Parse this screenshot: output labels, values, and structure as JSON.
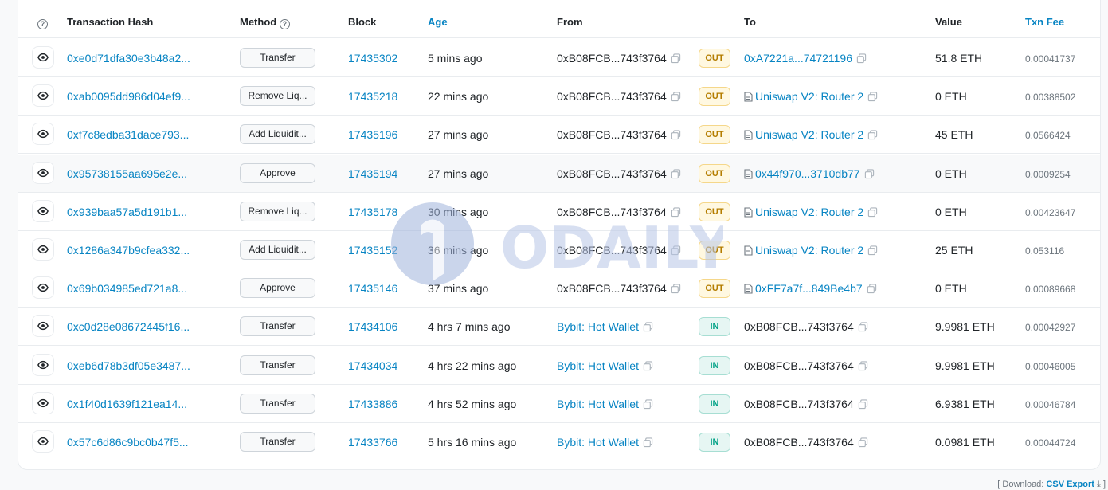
{
  "table": {
    "headers": {
      "txn_hash": "Transaction Hash",
      "method": "Method",
      "block": "Block",
      "age": "Age",
      "from": "From",
      "to": "To",
      "value": "Value",
      "txn_fee": "Txn Fee"
    },
    "rows": [
      {
        "hash": "0xe0d71dfa30e3b48a2...",
        "method": "Transfer",
        "block": "17435302",
        "age": "5 mins ago",
        "from": "0xB08FCB...743f3764",
        "direction": "OUT",
        "to": "0xA7221a...74721196",
        "value": "51.8 ETH",
        "fee": "0.00041737"
      },
      {
        "hash": "0xab0095dd986d04ef9...",
        "method": "Remove Liq...",
        "block": "17435218",
        "age": "22 mins ago",
        "from": "0xB08FCB...743f3764",
        "direction": "OUT",
        "to": "Uniswap V2: Router 2",
        "value": "0 ETH",
        "fee": "0.00388502"
      },
      {
        "hash": "0xf7c8edba31dace793...",
        "method": "Add Liquidit...",
        "block": "17435196",
        "age": "27 mins ago",
        "from": "0xB08FCB...743f3764",
        "direction": "OUT",
        "to": "Uniswap V2: Router 2",
        "value": "45 ETH",
        "fee": "0.0566424"
      },
      {
        "hash": "0x95738155aa695e2e...",
        "method": "Approve",
        "block": "17435194",
        "age": "27 mins ago",
        "from": "0xB08FCB...743f3764",
        "direction": "OUT",
        "to": "0x44f970...3710db77",
        "value": "0 ETH",
        "fee": "0.0009254"
      },
      {
        "hash": "0x939baa57a5d191b1...",
        "method": "Remove Liq...",
        "block": "17435178",
        "age": "30 mins ago",
        "from": "0xB08FCB...743f3764",
        "direction": "OUT",
        "to": "Uniswap V2: Router 2",
        "value": "0 ETH",
        "fee": "0.00423647"
      },
      {
        "hash": "0x1286a347b9cfea332...",
        "method": "Add Liquidit...",
        "block": "17435152",
        "age": "36 mins ago",
        "from": "0xB08FCB...743f3764",
        "direction": "OUT",
        "to": "Uniswap V2: Router 2",
        "value": "25 ETH",
        "fee": "0.053116"
      },
      {
        "hash": "0x69b034985ed721a8...",
        "method": "Approve",
        "block": "17435146",
        "age": "37 mins ago",
        "from": "0xB08FCB...743f3764",
        "direction": "OUT",
        "to": "0xFF7a7f...849Be4b7",
        "value": "0 ETH",
        "fee": "0.00089668"
      },
      {
        "hash": "0xc0d28e08672445f16...",
        "method": "Transfer",
        "block": "17434106",
        "age": "4 hrs 7 mins ago",
        "from": "Bybit: Hot Wallet",
        "direction": "IN",
        "to": "0xB08FCB...743f3764",
        "value": "9.9981 ETH",
        "fee": "0.00042927"
      },
      {
        "hash": "0xeb6d78b3df05e3487...",
        "method": "Transfer",
        "block": "17434034",
        "age": "4 hrs 22 mins ago",
        "from": "Bybit: Hot Wallet",
        "direction": "IN",
        "to": "0xB08FCB...743f3764",
        "value": "9.9981 ETH",
        "fee": "0.00046005"
      },
      {
        "hash": "0x1f40d1639f121ea14...",
        "method": "Transfer",
        "block": "17433886",
        "age": "4 hrs 52 mins ago",
        "from": "Bybit: Hot Wallet",
        "direction": "IN",
        "to": "0xB08FCB...743f3764",
        "value": "6.9381 ETH",
        "fee": "0.00046784"
      },
      {
        "hash": "0x57c6d86c9bc0b47f5...",
        "method": "Transfer",
        "block": "17433766",
        "age": "5 hrs 16 mins ago",
        "from": "Bybit: Hot Wallet",
        "direction": "IN",
        "to": "0xB08FCB...743f3764",
        "value": "0.0981 ETH",
        "fee": "0.00044724"
      }
    ]
  },
  "footer": {
    "prefix": "[ Download:",
    "csv_label": "CSV Export",
    "suffix": "]"
  },
  "watermark": {
    "text": "ODAILY"
  },
  "colors": {
    "link": "#0784c3",
    "out_badge": "#b47d00",
    "in_badge": "#00a186"
  }
}
